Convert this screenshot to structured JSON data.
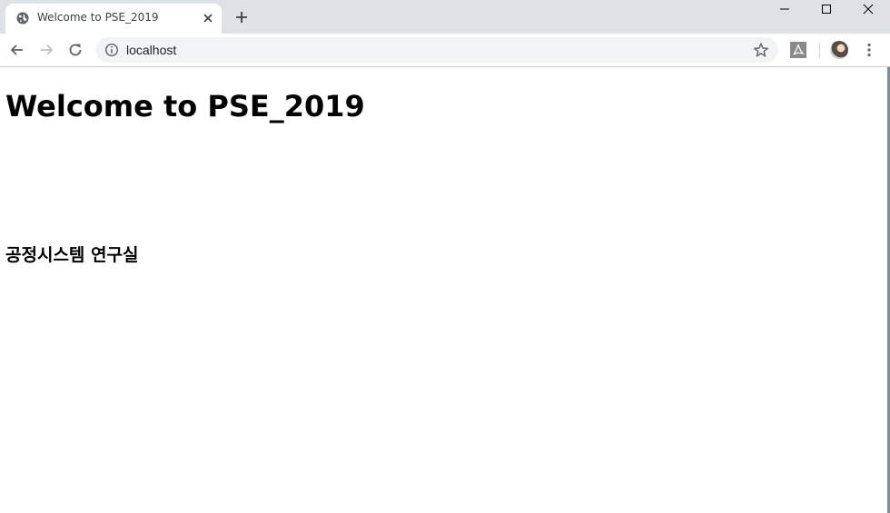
{
  "browser": {
    "tab": {
      "title": "Welcome to PSE_2019",
      "favicon": "globe-icon"
    },
    "address_bar": {
      "url": "localhost"
    },
    "accent_color": "#dee1e6"
  },
  "page": {
    "title": "Welcome to PSE_2019",
    "subtitle": "공정시스템 연구실"
  }
}
